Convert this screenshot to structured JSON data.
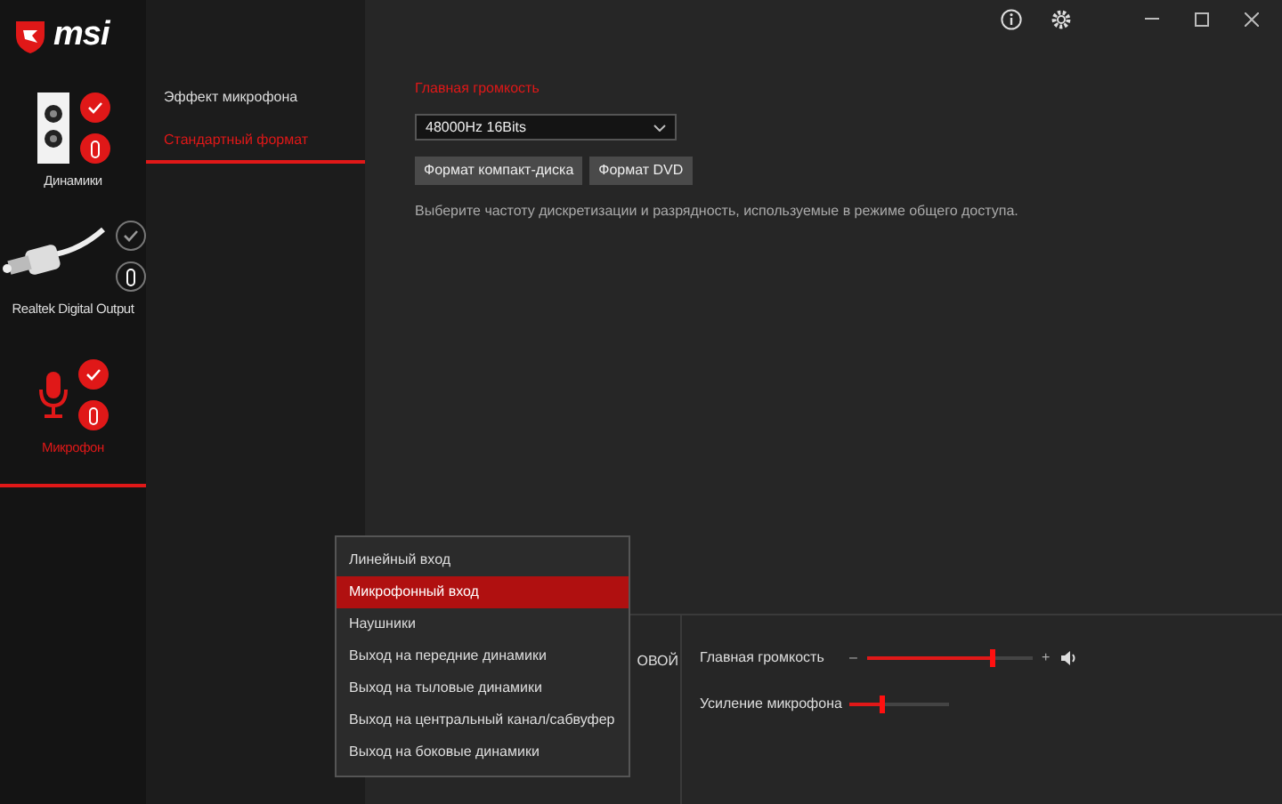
{
  "logo": "msi",
  "devices": [
    {
      "name": "Динамики",
      "kind": "speaker",
      "selected": false,
      "highlighted": true,
      "connected": true
    },
    {
      "name": "Realtek Digital Output",
      "kind": "optical",
      "selected": false,
      "highlighted": false,
      "connected": false
    },
    {
      "name": "Микрофон",
      "kind": "mic",
      "selected": true,
      "highlighted": true,
      "connected": true
    }
  ],
  "tabs": [
    {
      "label": "Эффект микрофона",
      "selected": false
    },
    {
      "label": "Стандартный формат",
      "selected": true
    }
  ],
  "format": {
    "title": "Главная громкость",
    "select_value": "48000Hz 16Bits",
    "buttons": [
      "Формат компакт-диска",
      "Формат DVD"
    ],
    "description": "Выберите частоту дискретизации и разрядность, используемые в режиме общего доступа."
  },
  "bottom": {
    "partial_label": "ОВОЙ",
    "sliders": [
      {
        "kind": "volume",
        "label": "Главная громкость",
        "level": 0.75,
        "minus": "–",
        "plus": "+"
      },
      {
        "kind": "gain",
        "label": "Усиление микрофона",
        "level": 0.33
      }
    ]
  },
  "jack_menu": [
    {
      "label": "Линейный вход",
      "selected": false
    },
    {
      "label": "Микрофонный вход",
      "selected": true
    },
    {
      "label": "Наушники",
      "selected": false
    },
    {
      "label": "Выход на передние динамики",
      "selected": false
    },
    {
      "label": "Выход на тыловые динамики",
      "selected": false
    },
    {
      "label": "Выход на центральный канал/сабвуфер",
      "selected": false
    },
    {
      "label": "Выход на боковые динамики",
      "selected": false
    }
  ]
}
